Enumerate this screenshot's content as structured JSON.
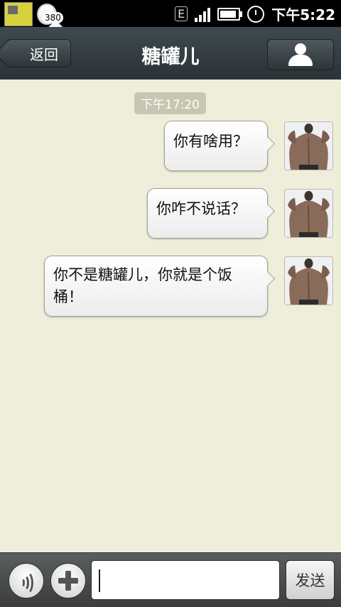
{
  "status_bar": {
    "notification_badge": "380",
    "network": "E",
    "time": "下午5:22"
  },
  "header": {
    "back_label": "返回",
    "title": "糖罐儿"
  },
  "chat": {
    "timestamp": "下午17:20",
    "messages": [
      {
        "sender": "me",
        "text": "你有啥用？"
      },
      {
        "sender": "me",
        "text": "你咋不说话？"
      },
      {
        "sender": "me",
        "text": "你不是糖罐儿，你就是个饭桶！"
      }
    ]
  },
  "input_bar": {
    "message_value": "",
    "send_label": "发送"
  },
  "colors": {
    "chat_background": "#efeedb",
    "title_bar": "#343d41",
    "time_chip": "#c7c6b1"
  }
}
